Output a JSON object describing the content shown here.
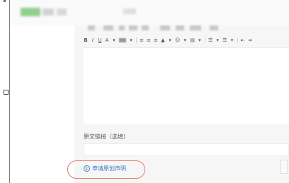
{
  "top_bar": {
    "blurred": true
  },
  "toolbar_row1": {
    "blurred": true,
    "item_count": 9
  },
  "toolbar": {
    "buttons": [
      "B",
      "I",
      "U",
      "A",
      "▾"
    ],
    "alignment_icons": [
      "align-left-icon",
      "align-center-icon",
      "align-right-icon"
    ]
  },
  "source_link": {
    "label": "原文链接（选填）",
    "value": ""
  },
  "original_claim": {
    "label": "申请原创声明"
  },
  "colors": {
    "link": "#3b7bbf",
    "highlight_circle": "#e07f6a"
  }
}
